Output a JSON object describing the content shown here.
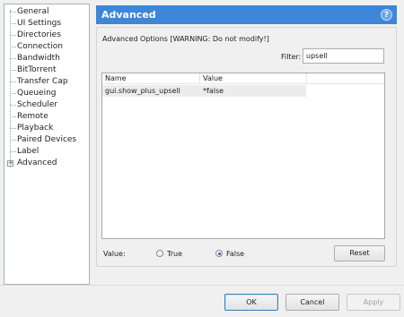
{
  "tree": {
    "items": [
      {
        "label": "General"
      },
      {
        "label": "UI Settings"
      },
      {
        "label": "Directories"
      },
      {
        "label": "Connection"
      },
      {
        "label": "Bandwidth"
      },
      {
        "label": "BitTorrent"
      },
      {
        "label": "Transfer Cap"
      },
      {
        "label": "Queueing"
      },
      {
        "label": "Scheduler"
      },
      {
        "label": "Remote"
      },
      {
        "label": "Playback"
      },
      {
        "label": "Paired Devices"
      },
      {
        "label": "Label"
      },
      {
        "label": "Advanced",
        "expander": "+"
      }
    ]
  },
  "header": {
    "title": "Advanced",
    "help_icon": "?",
    "color": "#3d86d8"
  },
  "group": {
    "title": "Advanced Options [WARNING: Do not modify!]"
  },
  "filter": {
    "label": "Filter:",
    "value": "upsell"
  },
  "grid": {
    "columns": [
      "Name",
      "Value"
    ],
    "rows": [
      {
        "name": "gui.show_plus_upsell",
        "value": "*false"
      }
    ]
  },
  "value_editor": {
    "label": "Value:",
    "true_label": "True",
    "false_label": "False",
    "selected": "False",
    "reset_label": "Reset"
  },
  "footer": {
    "ok_label": "OK",
    "cancel_label": "Cancel",
    "apply_label": "Apply"
  }
}
